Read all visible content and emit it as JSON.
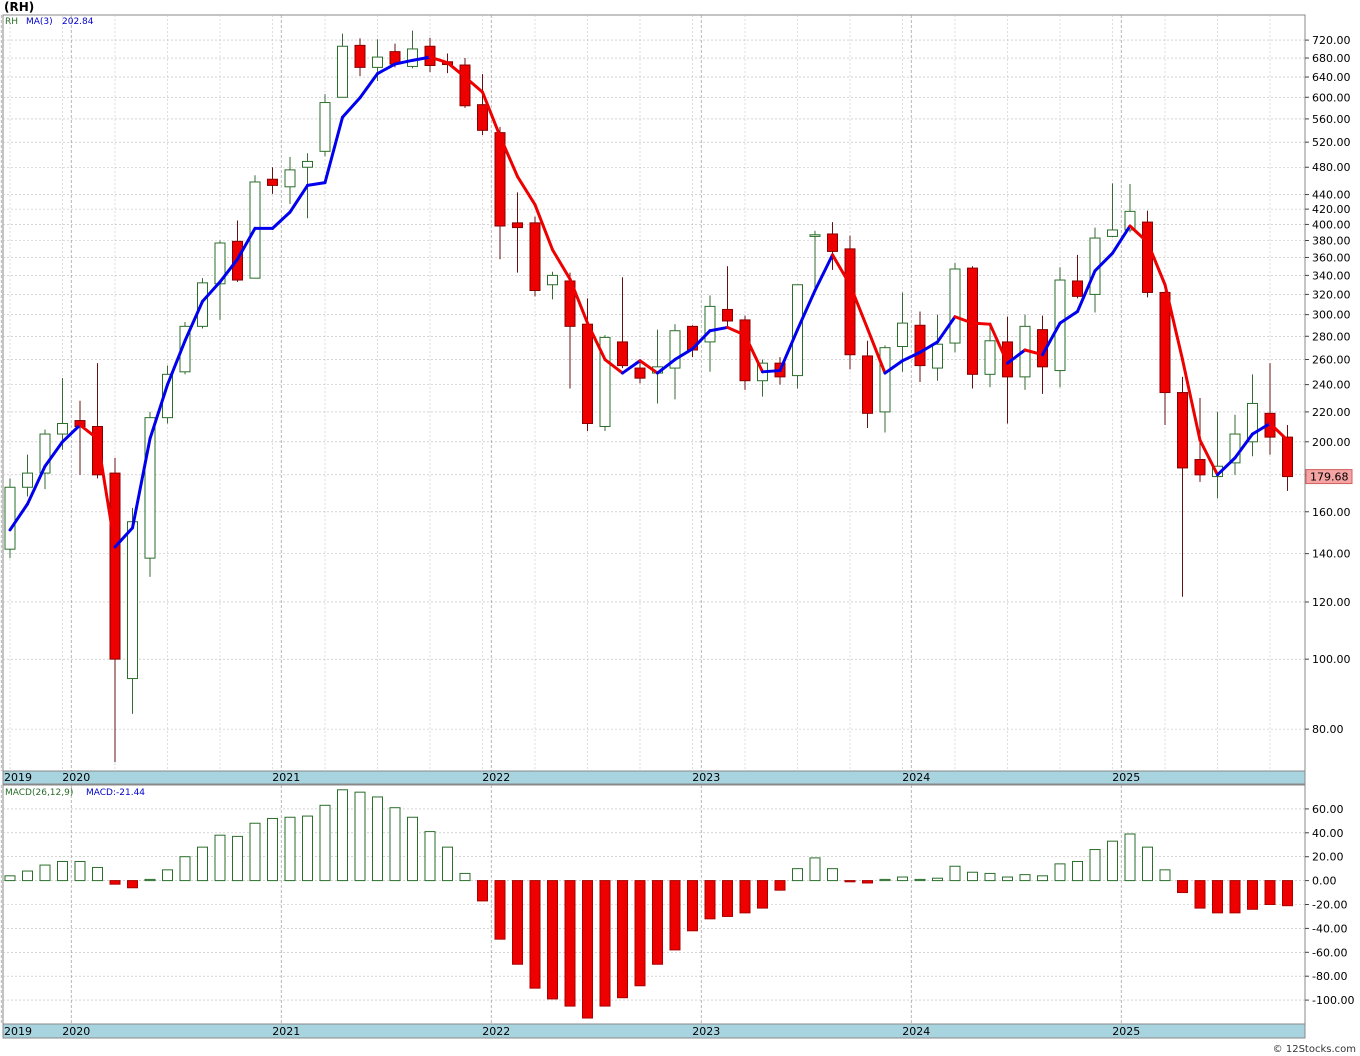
{
  "title": "(RH)",
  "footer": "© 12Stocks.com",
  "colors": {
    "up": "#2a6e2a",
    "down": "#ee0000",
    "ma_up": "#0000ee",
    "ma_down": "#ee0000",
    "year_band": "#a8d4e0",
    "grid": "#bbbbbb",
    "last_price_bg": "#f5a3a3"
  },
  "chart_data": [
    {
      "type": "candlestick",
      "scale": "log",
      "legend": {
        "symbol": "RH",
        "ma_label": "MA(3)",
        "ma_value": "202.84"
      },
      "last_price_label": "179.68",
      "ylim": [
        70,
        780
      ],
      "yticks": [
        80,
        100,
        120,
        140,
        160,
        180,
        200,
        220,
        240,
        260,
        280,
        300,
        320,
        340,
        360,
        380,
        400,
        420,
        440,
        480,
        520,
        560,
        600,
        640,
        680,
        720
      ],
      "ytick_labels": [
        "80.00",
        "100.00",
        "120.00",
        "140.00",
        "160.00",
        "180.00",
        "200.00",
        "220.00",
        "240.00",
        "260.00",
        "280.00",
        "300.00",
        "320.00",
        "340.00",
        "360.00",
        "380.00",
        "400.00",
        "420.00",
        "440.00",
        "480.00",
        "520.00",
        "560.00",
        "600.00",
        "640.00",
        "680.00",
        "720.00"
      ],
      "x_labels": [
        {
          "label": "2019",
          "month": 0
        },
        {
          "label": "2020",
          "month": 4
        },
        {
          "label": "2021",
          "month": 16
        },
        {
          "label": "2022",
          "month": 28
        },
        {
          "label": "2023",
          "month": 40
        },
        {
          "label": "2024",
          "month": 52
        },
        {
          "label": "2025",
          "month": 64
        }
      ],
      "candles": [
        {
          "o": 142,
          "h": 178,
          "l": 138,
          "c": 173
        },
        {
          "o": 173,
          "h": 192,
          "l": 168,
          "c": 181
        },
        {
          "o": 181,
          "h": 208,
          "l": 172,
          "c": 205
        },
        {
          "o": 205,
          "h": 245,
          "l": 195,
          "c": 212
        },
        {
          "o": 214,
          "h": 228,
          "l": 180,
          "c": 210
        },
        {
          "o": 210,
          "h": 257,
          "l": 178,
          "c": 180
        },
        {
          "o": 181,
          "h": 190,
          "l": 72,
          "c": 100
        },
        {
          "o": 94,
          "h": 162,
          "l": 84,
          "c": 155
        },
        {
          "o": 138,
          "h": 220,
          "l": 130,
          "c": 216
        },
        {
          "o": 216,
          "h": 255,
          "l": 212,
          "c": 248
        },
        {
          "o": 250,
          "h": 293,
          "l": 248,
          "c": 289
        },
        {
          "o": 289,
          "h": 337,
          "l": 287,
          "c": 332
        },
        {
          "o": 331,
          "h": 380,
          "l": 295,
          "c": 377
        },
        {
          "o": 379,
          "h": 405,
          "l": 333,
          "c": 335
        },
        {
          "o": 337,
          "h": 468,
          "l": 337,
          "c": 458
        },
        {
          "o": 462,
          "h": 480,
          "l": 441,
          "c": 453
        },
        {
          "o": 451,
          "h": 496,
          "l": 427,
          "c": 476
        },
        {
          "o": 480,
          "h": 502,
          "l": 408,
          "c": 489
        },
        {
          "o": 505,
          "h": 606,
          "l": 497,
          "c": 590
        },
        {
          "o": 600,
          "h": 735,
          "l": 600,
          "c": 706
        },
        {
          "o": 708,
          "h": 724,
          "l": 642,
          "c": 660
        },
        {
          "o": 660,
          "h": 722,
          "l": 632,
          "c": 682
        },
        {
          "o": 694,
          "h": 712,
          "l": 660,
          "c": 667
        },
        {
          "o": 662,
          "h": 742,
          "l": 658,
          "c": 700
        },
        {
          "o": 706,
          "h": 725,
          "l": 650,
          "c": 664
        },
        {
          "o": 672,
          "h": 690,
          "l": 648,
          "c": 666
        },
        {
          "o": 665,
          "h": 680,
          "l": 580,
          "c": 584
        },
        {
          "o": 586,
          "h": 646,
          "l": 532,
          "c": 540
        },
        {
          "o": 536,
          "h": 546,
          "l": 358,
          "c": 398
        },
        {
          "o": 402,
          "h": 443,
          "l": 343,
          "c": 396
        },
        {
          "o": 402,
          "h": 410,
          "l": 318,
          "c": 324
        },
        {
          "o": 330,
          "h": 344,
          "l": 315,
          "c": 340
        },
        {
          "o": 334,
          "h": 343,
          "l": 237,
          "c": 289
        },
        {
          "o": 291,
          "h": 316,
          "l": 207,
          "c": 212
        },
        {
          "o": 210,
          "h": 281,
          "l": 207,
          "c": 279
        },
        {
          "o": 275,
          "h": 338,
          "l": 253,
          "c": 255
        },
        {
          "o": 253,
          "h": 258,
          "l": 241,
          "c": 245
        },
        {
          "o": 249,
          "h": 286,
          "l": 226,
          "c": 254
        },
        {
          "o": 253,
          "h": 291,
          "l": 229,
          "c": 285
        },
        {
          "o": 289,
          "h": 290,
          "l": 262,
          "c": 268
        },
        {
          "o": 275,
          "h": 319,
          "l": 250,
          "c": 308
        },
        {
          "o": 305,
          "h": 350,
          "l": 289,
          "c": 294
        },
        {
          "o": 295,
          "h": 299,
          "l": 236,
          "c": 243
        },
        {
          "o": 243,
          "h": 260,
          "l": 231,
          "c": 257
        },
        {
          "o": 257,
          "h": 262,
          "l": 240,
          "c": 246
        },
        {
          "o": 247,
          "h": 330,
          "l": 237,
          "c": 330
        },
        {
          "o": 385,
          "h": 392,
          "l": 323,
          "c": 387
        },
        {
          "o": 388,
          "h": 403,
          "l": 346,
          "c": 367
        },
        {
          "o": 370,
          "h": 386,
          "l": 252,
          "c": 264
        },
        {
          "o": 263,
          "h": 276,
          "l": 209,
          "c": 219
        },
        {
          "o": 220,
          "h": 272,
          "l": 206,
          "c": 270
        },
        {
          "o": 271,
          "h": 322,
          "l": 250,
          "c": 292
        },
        {
          "o": 290,
          "h": 303,
          "l": 242,
          "c": 255
        },
        {
          "o": 253,
          "h": 300,
          "l": 243,
          "c": 273
        },
        {
          "o": 274,
          "h": 354,
          "l": 266,
          "c": 347
        },
        {
          "o": 348,
          "h": 350,
          "l": 237,
          "c": 248
        },
        {
          "o": 248,
          "h": 290,
          "l": 238,
          "c": 276
        },
        {
          "o": 275,
          "h": 298,
          "l": 212,
          "c": 246
        },
        {
          "o": 246,
          "h": 300,
          "l": 236,
          "c": 289
        },
        {
          "o": 286,
          "h": 299,
          "l": 233,
          "c": 254
        },
        {
          "o": 251,
          "h": 349,
          "l": 238,
          "c": 335
        },
        {
          "o": 334,
          "h": 363,
          "l": 316,
          "c": 318
        },
        {
          "o": 320,
          "h": 396,
          "l": 302,
          "c": 383
        },
        {
          "o": 385,
          "h": 456,
          "l": 384,
          "c": 393
        },
        {
          "o": 393,
          "h": 455,
          "l": 390,
          "c": 417
        },
        {
          "o": 403,
          "h": 418,
          "l": 317,
          "c": 322
        },
        {
          "o": 322,
          "h": 323,
          "l": 211,
          "c": 234
        },
        {
          "o": 234,
          "h": 246,
          "l": 122,
          "c": 184
        },
        {
          "o": 189,
          "h": 230,
          "l": 176,
          "c": 180
        },
        {
          "o": 179,
          "h": 220,
          "l": 167,
          "c": 185
        },
        {
          "o": 187,
          "h": 218,
          "l": 180,
          "c": 205
        },
        {
          "o": 200,
          "h": 248,
          "l": 191,
          "c": 226
        },
        {
          "o": 219,
          "h": 257,
          "l": 192,
          "c": 203
        },
        {
          "o": 203,
          "h": 211,
          "l": 171,
          "c": 179
        }
      ],
      "ma3": [
        151,
        164,
        185,
        200,
        211,
        202,
        143,
        152,
        202,
        240,
        276,
        313,
        333,
        358,
        395,
        395,
        416,
        453,
        457,
        563,
        599,
        647,
        667,
        675,
        682,
        670,
        640,
        610,
        530,
        466,
        426,
        369,
        336,
        292,
        260,
        249,
        259,
        249,
        260,
        269,
        285,
        288,
        281,
        250,
        251,
        286,
        324,
        363,
        330,
        287,
        249,
        259,
        266,
        275,
        298,
        292,
        291,
        257,
        268,
        264,
        292,
        303,
        345,
        365,
        398,
        378,
        330,
        260,
        201,
        180,
        190,
        205,
        212,
        201
      ],
      "ma3_up_at_end": 42
    },
    {
      "type": "bar",
      "legend": {
        "name": "MACD(26,12,9)",
        "value_label": "MACD:-21.44"
      },
      "ylim": [
        -120,
        80
      ],
      "yticks": [
        -100,
        -80,
        -60,
        -40,
        -20,
        0,
        20,
        40,
        60
      ],
      "ytick_labels": [
        "-100.00",
        "-80.00",
        "-60.00",
        "-40.00",
        "-20.00",
        "0.00",
        "20.00",
        "40.00",
        "60.00"
      ],
      "values": [
        4,
        8,
        13,
        16,
        16,
        11,
        -3,
        -6,
        1,
        9,
        20,
        28,
        38,
        37,
        48,
        52,
        53,
        54,
        63,
        76,
        74,
        70,
        61,
        53,
        41,
        28,
        6,
        -17,
        -49,
        -70,
        -90,
        -99,
        -105,
        -115,
        -105,
        -98,
        -88,
        -70,
        -58,
        -42,
        -32,
        -30,
        -27,
        -23,
        -8,
        10,
        19,
        10,
        -1,
        -2,
        1,
        3,
        1,
        2,
        12,
        7,
        6,
        3,
        5,
        4,
        14,
        16,
        26,
        33,
        39,
        28,
        9,
        -10,
        -23,
        -27,
        -27,
        -24,
        -20,
        -21
      ]
    }
  ]
}
